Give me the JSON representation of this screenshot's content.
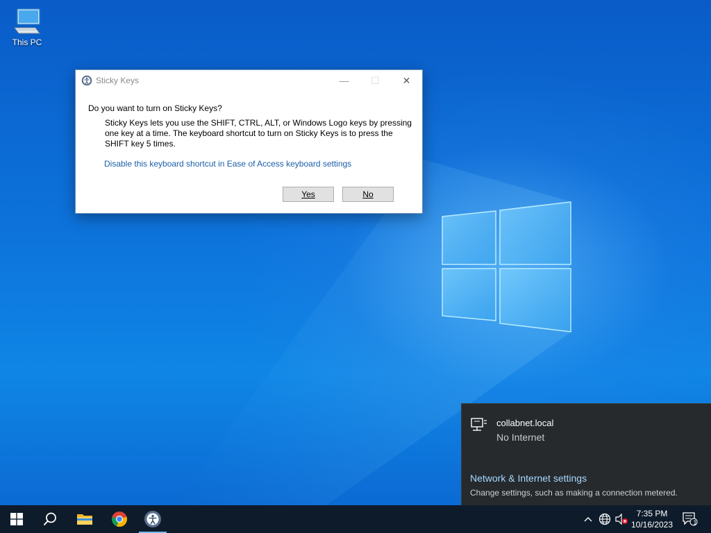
{
  "desktop": {
    "icons": [
      {
        "label": "This PC",
        "icon": "computer-icon"
      }
    ]
  },
  "dialog": {
    "title": "Sticky Keys",
    "question": "Do you want to turn on Sticky Keys?",
    "body": "Sticky Keys lets you use the SHIFT, CTRL, ALT, or Windows Logo keys by pressing one key at a time. The keyboard shortcut to turn on Sticky Keys is to press the SHIFT key 5 times.",
    "link": "Disable this keyboard shortcut in Ease of Access keyboard settings",
    "buttons": {
      "yes": "Yes",
      "no": "No"
    },
    "controls": {
      "minimize": "—",
      "maximize": "☐",
      "close": "✕"
    }
  },
  "network_flyout": {
    "network_name": "collabnet.local",
    "status": "No Internet",
    "settings_link": "Network & Internet settings",
    "settings_desc": "Change settings, such as making a connection metered."
  },
  "taskbar": {
    "pinned": [
      {
        "name": "start",
        "icon": "windows-logo-icon"
      },
      {
        "name": "search",
        "icon": "search-icon"
      },
      {
        "name": "file-explorer",
        "icon": "folder-icon"
      },
      {
        "name": "chrome",
        "icon": "chrome-icon"
      },
      {
        "name": "ease-of-access",
        "icon": "ease-of-access-icon"
      }
    ],
    "tray": {
      "time": "7:35 PM",
      "date": "10/16/2023",
      "notification_count": "1"
    }
  },
  "colors": {
    "desktop_bg": "#0d74dc",
    "taskbar_bg": "#0e1b2a",
    "flyout_bg": "#262a2d",
    "link_blue": "#1a5fa8",
    "flyout_link": "#a6d8ff"
  }
}
